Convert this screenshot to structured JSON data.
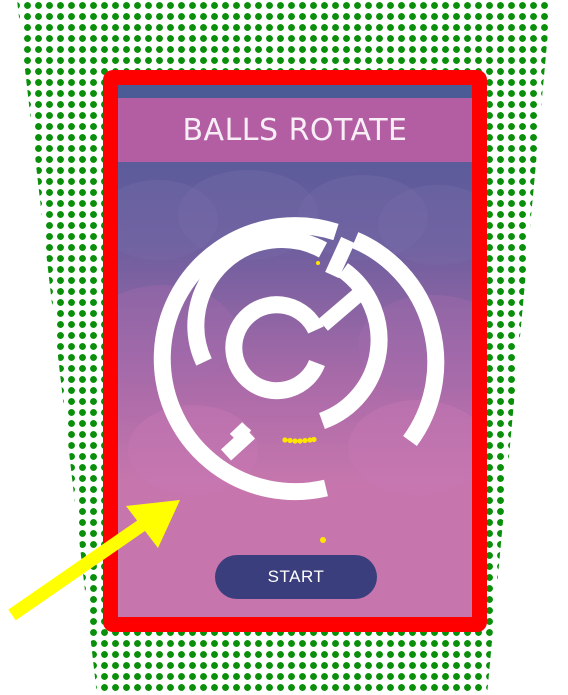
{
  "game": {
    "title": "BALLS ROTATE",
    "start_label": "START",
    "ball_count_in_maze": 7
  },
  "colors": {
    "frame": "#ff0000",
    "title_bar": "#b35ea3",
    "button": "#3a3e7c",
    "ball": "#ffe600",
    "arrow": "#ffff00",
    "pattern": "#0a8f0a"
  },
  "icons": {
    "pointer": "yellow-arrow-icon",
    "ball": "yellow-ball-icon"
  }
}
